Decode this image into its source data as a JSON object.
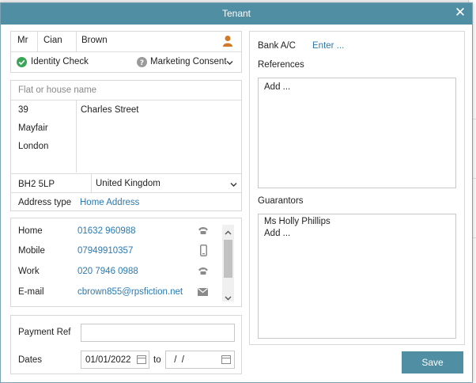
{
  "dialog": {
    "title": "Tenant",
    "close_glyph": "✕"
  },
  "name": {
    "salutation": "Mr",
    "first": "Cian",
    "last": "Brown",
    "icon": "person-icon"
  },
  "checks": {
    "identity_label": "Identity Check",
    "identity_icon": "check-circle-icon",
    "marketing_label": "Marketing Consent",
    "marketing_icon": "question-circle-icon"
  },
  "address": {
    "flat_placeholder": "Flat or house name",
    "number": "39",
    "street": "Charles Street",
    "line2": "Mayfair",
    "line3": "London",
    "postcode": "BH2 5LP",
    "country": "United Kingdom",
    "type_label": "Address type",
    "type_value": "Home Address"
  },
  "contacts": [
    {
      "label": "Home",
      "value": "01632 960988",
      "icon": "phone-icon"
    },
    {
      "label": "Mobile",
      "value": "07949910357",
      "icon": "mobile-icon"
    },
    {
      "label": "Work",
      "value": "020 7946 0988",
      "icon": "phone-icon"
    },
    {
      "label": "E-mail",
      "value": "cbrown855@rpsfiction.net",
      "icon": "envelope-icon"
    }
  ],
  "payment": {
    "ref_label": "Payment Ref",
    "ref_value": "",
    "dates_label": "Dates",
    "date_from": "01/01/2022",
    "to_label": "to",
    "date_to": " /  /"
  },
  "bank": {
    "label": "Bank A/C",
    "action": "Enter ..."
  },
  "references": {
    "label": "References",
    "items": [
      "Add ..."
    ]
  },
  "guarantors": {
    "label": "Guarantors",
    "items": [
      "Ms Holly Phillips",
      "Add ..."
    ]
  },
  "footer": {
    "save_label": "Save"
  },
  "colors": {
    "accent": "#4f8ea3",
    "link": "#2a7ab0",
    "check": "#3aa655",
    "person": "#d07a2a"
  }
}
